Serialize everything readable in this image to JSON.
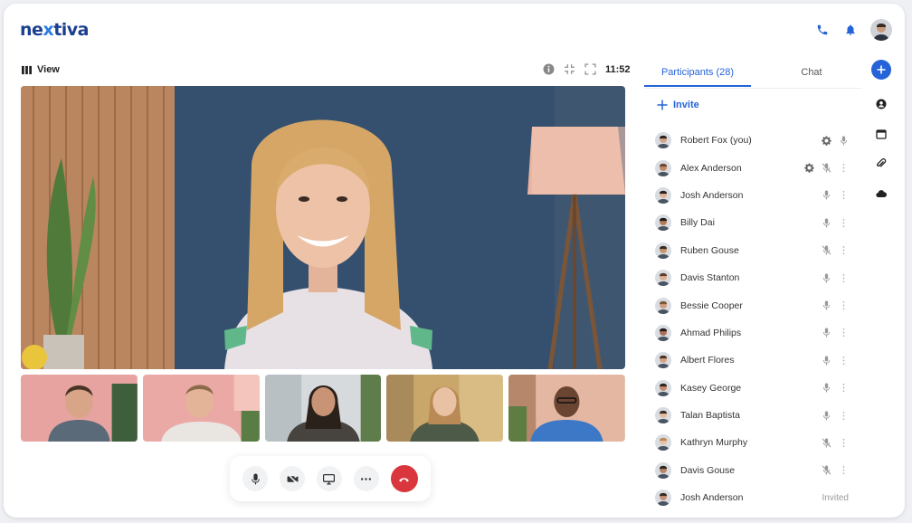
{
  "app": {
    "logo_text_a": "ne",
    "logo_text_x": "x",
    "logo_text_b": "tiva"
  },
  "colors": {
    "accent": "#2563d8",
    "brand": "#1b3f8f",
    "end_call": "#d9363e"
  },
  "viewbar": {
    "label": "View",
    "time": "11:52"
  },
  "tabs": {
    "participants": "Participants (28)",
    "chat": "Chat"
  },
  "invite": {
    "label": "Invite"
  },
  "participants": [
    {
      "name": "Robert Fox (you)",
      "icons": [
        "gear-icon",
        "mic-icon"
      ]
    },
    {
      "name": "Alex Anderson",
      "icons": [
        "gear-icon",
        "mic-off-icon",
        "more-icon"
      ]
    },
    {
      "name": "Josh Anderson",
      "icons": [
        "mic-icon",
        "more-icon"
      ]
    },
    {
      "name": "Billy Dai",
      "icons": [
        "mic-icon",
        "more-icon"
      ]
    },
    {
      "name": "Ruben Gouse",
      "icons": [
        "mic-off-icon",
        "more-icon"
      ]
    },
    {
      "name": "Davis Stanton",
      "icons": [
        "mic-icon",
        "more-icon"
      ]
    },
    {
      "name": "Bessie Cooper",
      "icons": [
        "mic-icon",
        "more-icon"
      ]
    },
    {
      "name": "Ahmad Philips",
      "icons": [
        "mic-icon",
        "more-icon"
      ]
    },
    {
      "name": "Albert Flores",
      "icons": [
        "mic-icon",
        "more-icon"
      ]
    },
    {
      "name": "Kasey George",
      "icons": [
        "mic-icon",
        "more-icon"
      ]
    },
    {
      "name": "Talan Baptista",
      "icons": [
        "mic-icon",
        "more-icon"
      ]
    },
    {
      "name": "Kathryn Murphy",
      "icons": [
        "mic-off-icon",
        "more-icon"
      ]
    },
    {
      "name": "Davis Gouse",
      "icons": [
        "mic-off-icon",
        "more-icon"
      ]
    },
    {
      "name": "Josh Anderson",
      "status": "Invited"
    }
  ]
}
